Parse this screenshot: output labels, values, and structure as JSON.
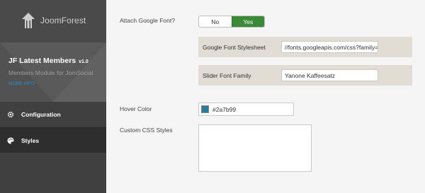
{
  "brand": {
    "name": "JoomForest"
  },
  "module": {
    "title": "JF Latest Members",
    "version": "v1.0",
    "subtitle": "Members Module for JomSocial",
    "more_info": "MORE INFO"
  },
  "nav": [
    {
      "label": "Configuration",
      "icon": "gear-icon"
    },
    {
      "label": "Styles",
      "icon": "palette-icon"
    }
  ],
  "form": {
    "attach_font": {
      "label": "Attach Google Font?",
      "options": [
        "No",
        "Yes"
      ],
      "selected": "Yes"
    },
    "font_stylesheet": {
      "label": "Google Font Stylesheet",
      "value": "//fonts.googleapis.com/css?family="
    },
    "slider_font": {
      "label": "Slider Font Family",
      "value": "Yanone Kaffeesatz"
    },
    "hover_color": {
      "label": "Hover Color",
      "value": "#2a7b99"
    },
    "custom_css": {
      "label": "Custom CSS Styles",
      "value": ""
    }
  },
  "colors": {
    "sidebar_bg": "#404040",
    "active_toggle": "#3a8a3a",
    "link": "#2a8fcf",
    "subrow_bg": "#e1ddd5"
  }
}
